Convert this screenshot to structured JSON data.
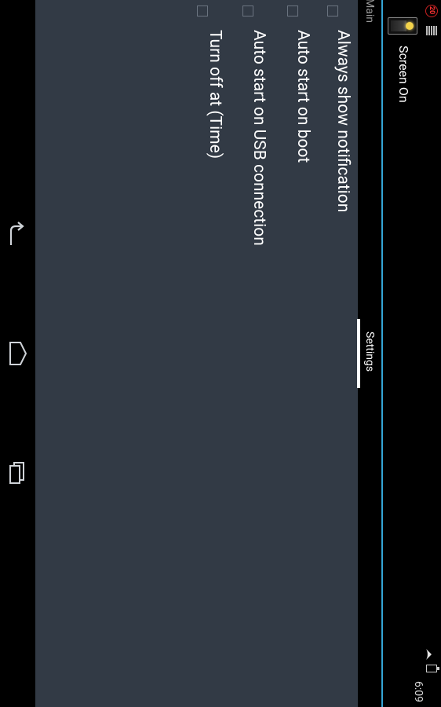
{
  "status_bar": {
    "notification_count": "20",
    "time": "6:09",
    "icons": [
      "notification-badge-icon",
      "bars-icon",
      "wifi-icon",
      "battery-icon"
    ]
  },
  "action_bar": {
    "app_title": "Screen On",
    "app_icon": "lightbulb-switch-icon",
    "divider_color": "#35a5d6"
  },
  "tabs": [
    {
      "label": "Main",
      "selected": false
    },
    {
      "label": "Settings",
      "selected": true
    }
  ],
  "settings": {
    "items": [
      {
        "label": "Always show notification",
        "checked": false
      },
      {
        "label": "Auto start on boot",
        "checked": false
      },
      {
        "label": "Auto start on USB connection",
        "checked": false
      },
      {
        "label": "Turn off at (Time)",
        "checked": false
      }
    ]
  },
  "nav_bar": {
    "icons": [
      "back-icon",
      "home-icon",
      "recent-apps-icon"
    ]
  },
  "colors": {
    "content_background": "#323a45",
    "accent": "#35a5d6",
    "text": "#ffffff"
  }
}
